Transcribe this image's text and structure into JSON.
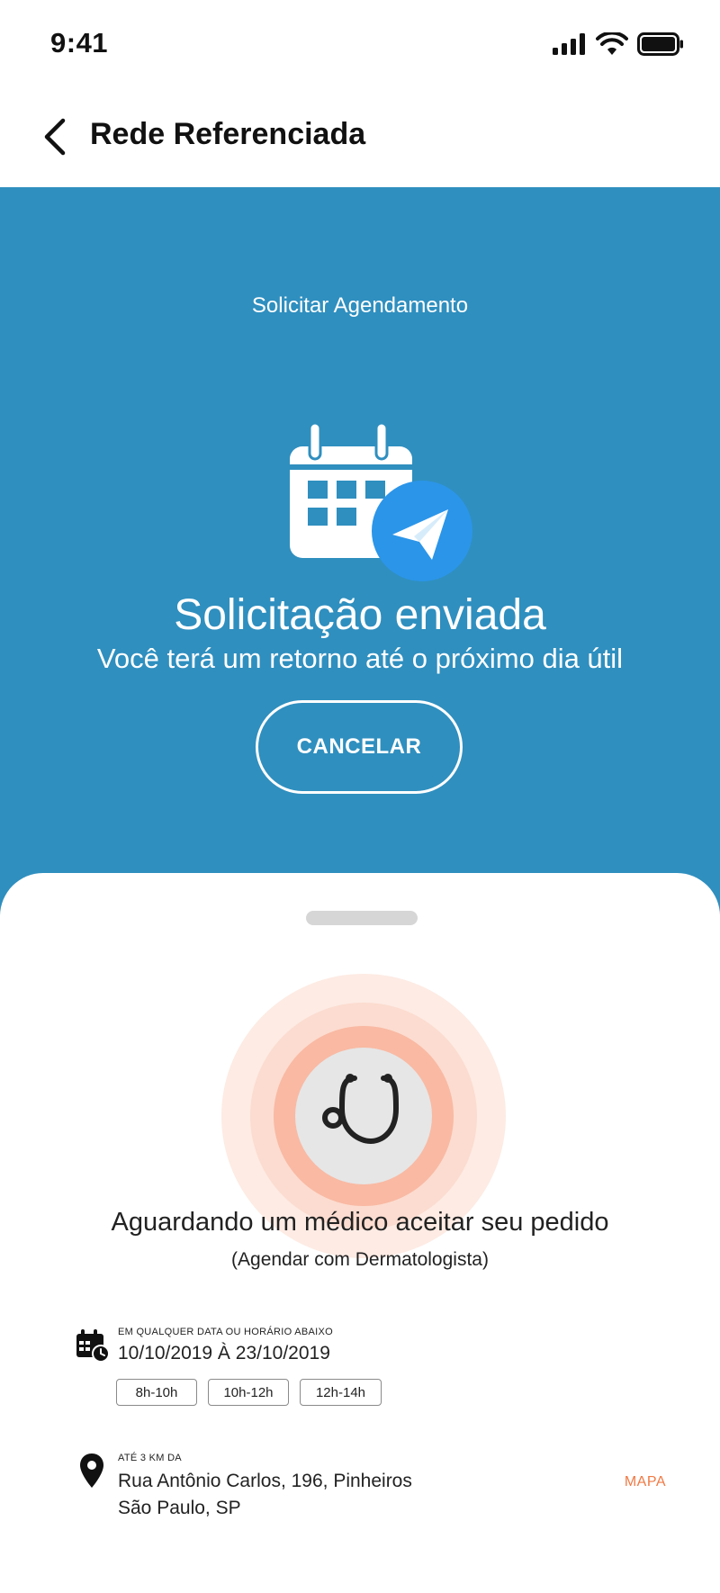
{
  "status_bar": {
    "time": "9:41"
  },
  "header": {
    "title": "Rede Referenciada"
  },
  "hero": {
    "caption": "Solicitar Agendamento",
    "title": "Solicitação enviada",
    "subtitle": "Você terá um retorno até o próximo dia útil",
    "cancel_label": "CANCELAR"
  },
  "sheet": {
    "waiting_title": "Aguardando um médico aceitar seu pedido",
    "waiting_subtitle": "(Agendar com Dermatologista)",
    "schedule": {
      "caption": "EM QUALQUER DATA OU HORÁRIO ABAIXO",
      "date_range": "10/10/2019 À 23/10/2019",
      "slots": [
        "8h-10h",
        "10h-12h",
        "12h-14h"
      ]
    },
    "location": {
      "caption": "ATÉ 3 KM DA",
      "line1": "Rua Antônio Carlos, 196, Pinheiros",
      "line2": "São Paulo, SP",
      "map_label": "MAPA"
    }
  },
  "colors": {
    "hero_bg": "#2F8FBF",
    "send_badge": "#2B95E9",
    "pulse_ring": "#F9B9A3",
    "map_link": "#F07A45"
  },
  "icons": {
    "back": "chevron-left-icon",
    "calendar": "calendar-icon",
    "send": "paper-plane-icon",
    "stethoscope": "stethoscope-icon",
    "schedule": "calendar-clock-icon",
    "location": "map-pin-icon"
  }
}
